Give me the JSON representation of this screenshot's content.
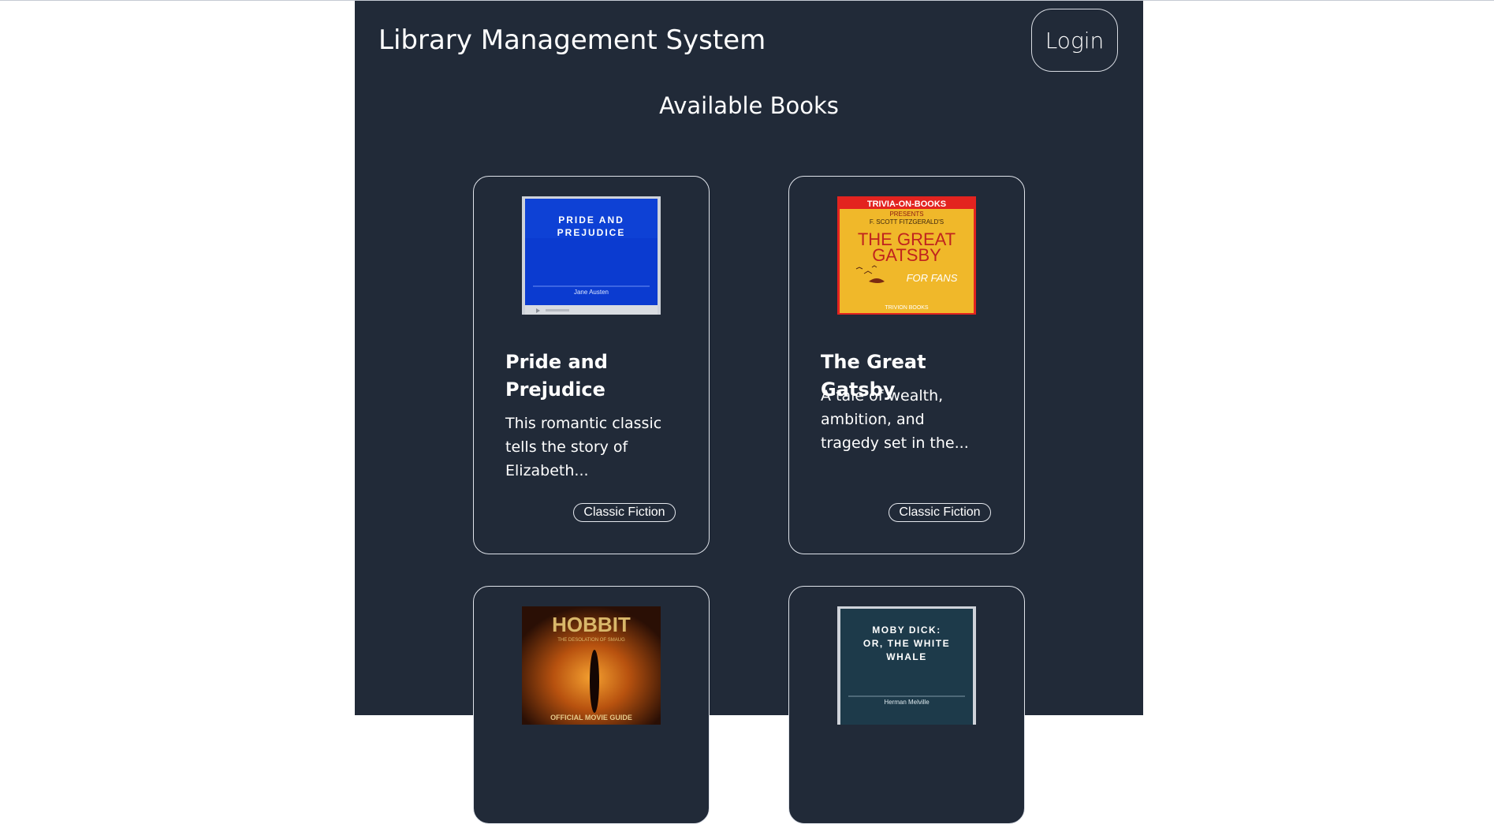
{
  "header": {
    "brand": "Library Management System",
    "login_label": "Login"
  },
  "main": {
    "title": "Available Books"
  },
  "books": [
    {
      "title": "Pride and Prejudice",
      "description": "This romantic classic tells the story of Elizabeth...",
      "genre": "Classic Fiction",
      "cover": {
        "title_line1": "PRIDE AND",
        "title_line2": "PREJUDICE",
        "author": "Jane Austen",
        "bg_color": "#0b3bd0"
      }
    },
    {
      "title": "The Great Gatsby",
      "description": "A tale of wealth, ambition, and tragedy set in the...",
      "genre": "Classic Fiction",
      "cover": {
        "banner": "TRIVIA-ON-BOOKS",
        "presents": "PRESENTS",
        "author": "F. SCOTT FITZGERALD'S",
        "title_line1": "THE GREAT",
        "title_line2": "GATSBY",
        "tagline": "FOR FANS",
        "publisher": "TRIVION BOOKS",
        "bg_color": "#f0b82a"
      }
    },
    {
      "title": "The Hobbit",
      "cover": {
        "title": "HOBBIT",
        "subtitle": "THE DESOLATION OF SMAUG",
        "footer": "OFFICIAL MOVIE GUIDE"
      }
    },
    {
      "title": "Moby Dick",
      "cover": {
        "title_line1": "MOBY DICK:",
        "title_line2": "OR, THE WHITE",
        "title_line3": "WHALE",
        "author": "Herman Melville",
        "bg_color": "#1d3a4a"
      }
    }
  ],
  "colors": {
    "page_bg": "#ffffff",
    "app_bg": "#212a38",
    "text": "#ffffff",
    "border": "#dfe3ea"
  }
}
